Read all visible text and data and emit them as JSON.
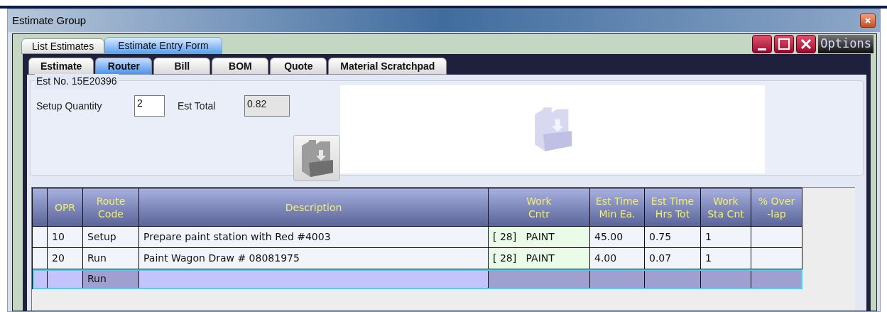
{
  "window": {
    "title": "Estimate Group"
  },
  "outer_tabs": [
    {
      "label": "List Estimates",
      "selected": false
    },
    {
      "label": "Estimate Entry Form",
      "selected": true
    }
  ],
  "options_label": "Options",
  "inner_tabs": [
    {
      "label": "Estimate",
      "selected": false
    },
    {
      "label": "Router",
      "selected": true
    },
    {
      "label": "Bill",
      "selected": false
    },
    {
      "label": "BOM",
      "selected": false
    },
    {
      "label": "Quote",
      "selected": false
    },
    {
      "label": "Material Scratchpad",
      "selected": false
    }
  ],
  "estimate": {
    "group_title": "Est No. 15E20396",
    "setup_quantity_label": "Setup Quantity",
    "setup_quantity": "2",
    "est_total_label": "Est Total",
    "est_total": "0.82"
  },
  "table": {
    "columns": [
      "OPR",
      "Route\nCode",
      "Description",
      "Work\nCntr",
      "Est Time\nMin Ea.",
      "Est Time\nHrs Tot",
      "Work\nSta Cnt",
      "% Over\n-lap"
    ],
    "rows": [
      {
        "selected": false,
        "cells": [
          "10",
          "Setup",
          "Prepare paint station with Red #4003",
          "[ 28]   PAINT",
          "45.00",
          "0.75",
          "1",
          ""
        ]
      },
      {
        "selected": false,
        "cells": [
          "20",
          "Run",
          "Paint Wagon Draw # 08081975",
          "[ 28]   PAINT",
          "4.00",
          "0.07",
          "1",
          ""
        ]
      },
      {
        "selected": true,
        "cells": [
          "",
          "Run",
          "",
          "",
          "",
          "",
          "",
          ""
        ]
      }
    ]
  }
}
